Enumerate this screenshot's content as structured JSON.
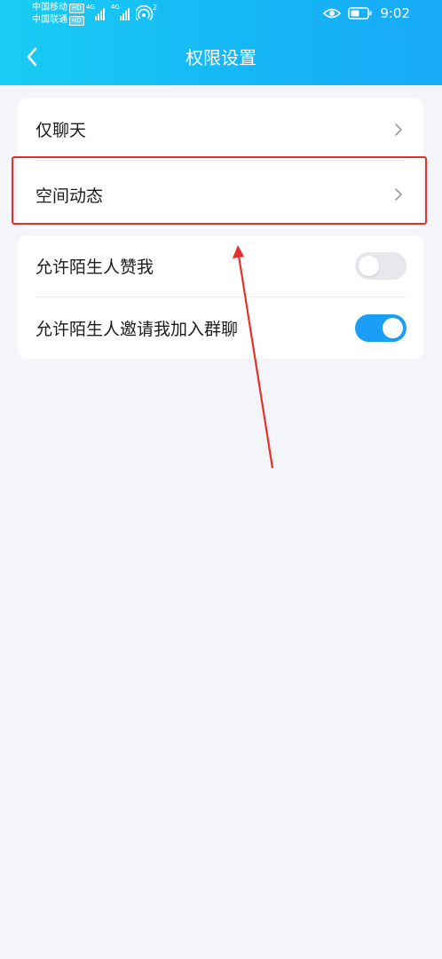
{
  "status_bar": {
    "carrier_1": "中国移动",
    "carrier_2": "中国联通",
    "hd_label": "HD",
    "network_1": "4G",
    "network_2": "4G",
    "hotspot_count": "2",
    "time": "9:02"
  },
  "header": {
    "title": "权限设置",
    "back_icon": "chevron-left-icon"
  },
  "settings": {
    "group1": [
      {
        "label": "仅聊天",
        "icon": "chevron-right-icon"
      },
      {
        "label": "空间动态",
        "icon": "chevron-right-icon"
      }
    ],
    "group2": [
      {
        "label": "允许陌生人赞我",
        "toggle_on": false
      },
      {
        "label": "允许陌生人邀请我加入群聊",
        "toggle_on": true
      }
    ]
  },
  "colors": {
    "header_start": "#19cdf4",
    "header_end": "#17aaf7",
    "toggle_on": "#1b9ef8",
    "toggle_off": "#e8e8ec",
    "annotation": "#e5302c",
    "page_background": "#f4f5f9"
  }
}
